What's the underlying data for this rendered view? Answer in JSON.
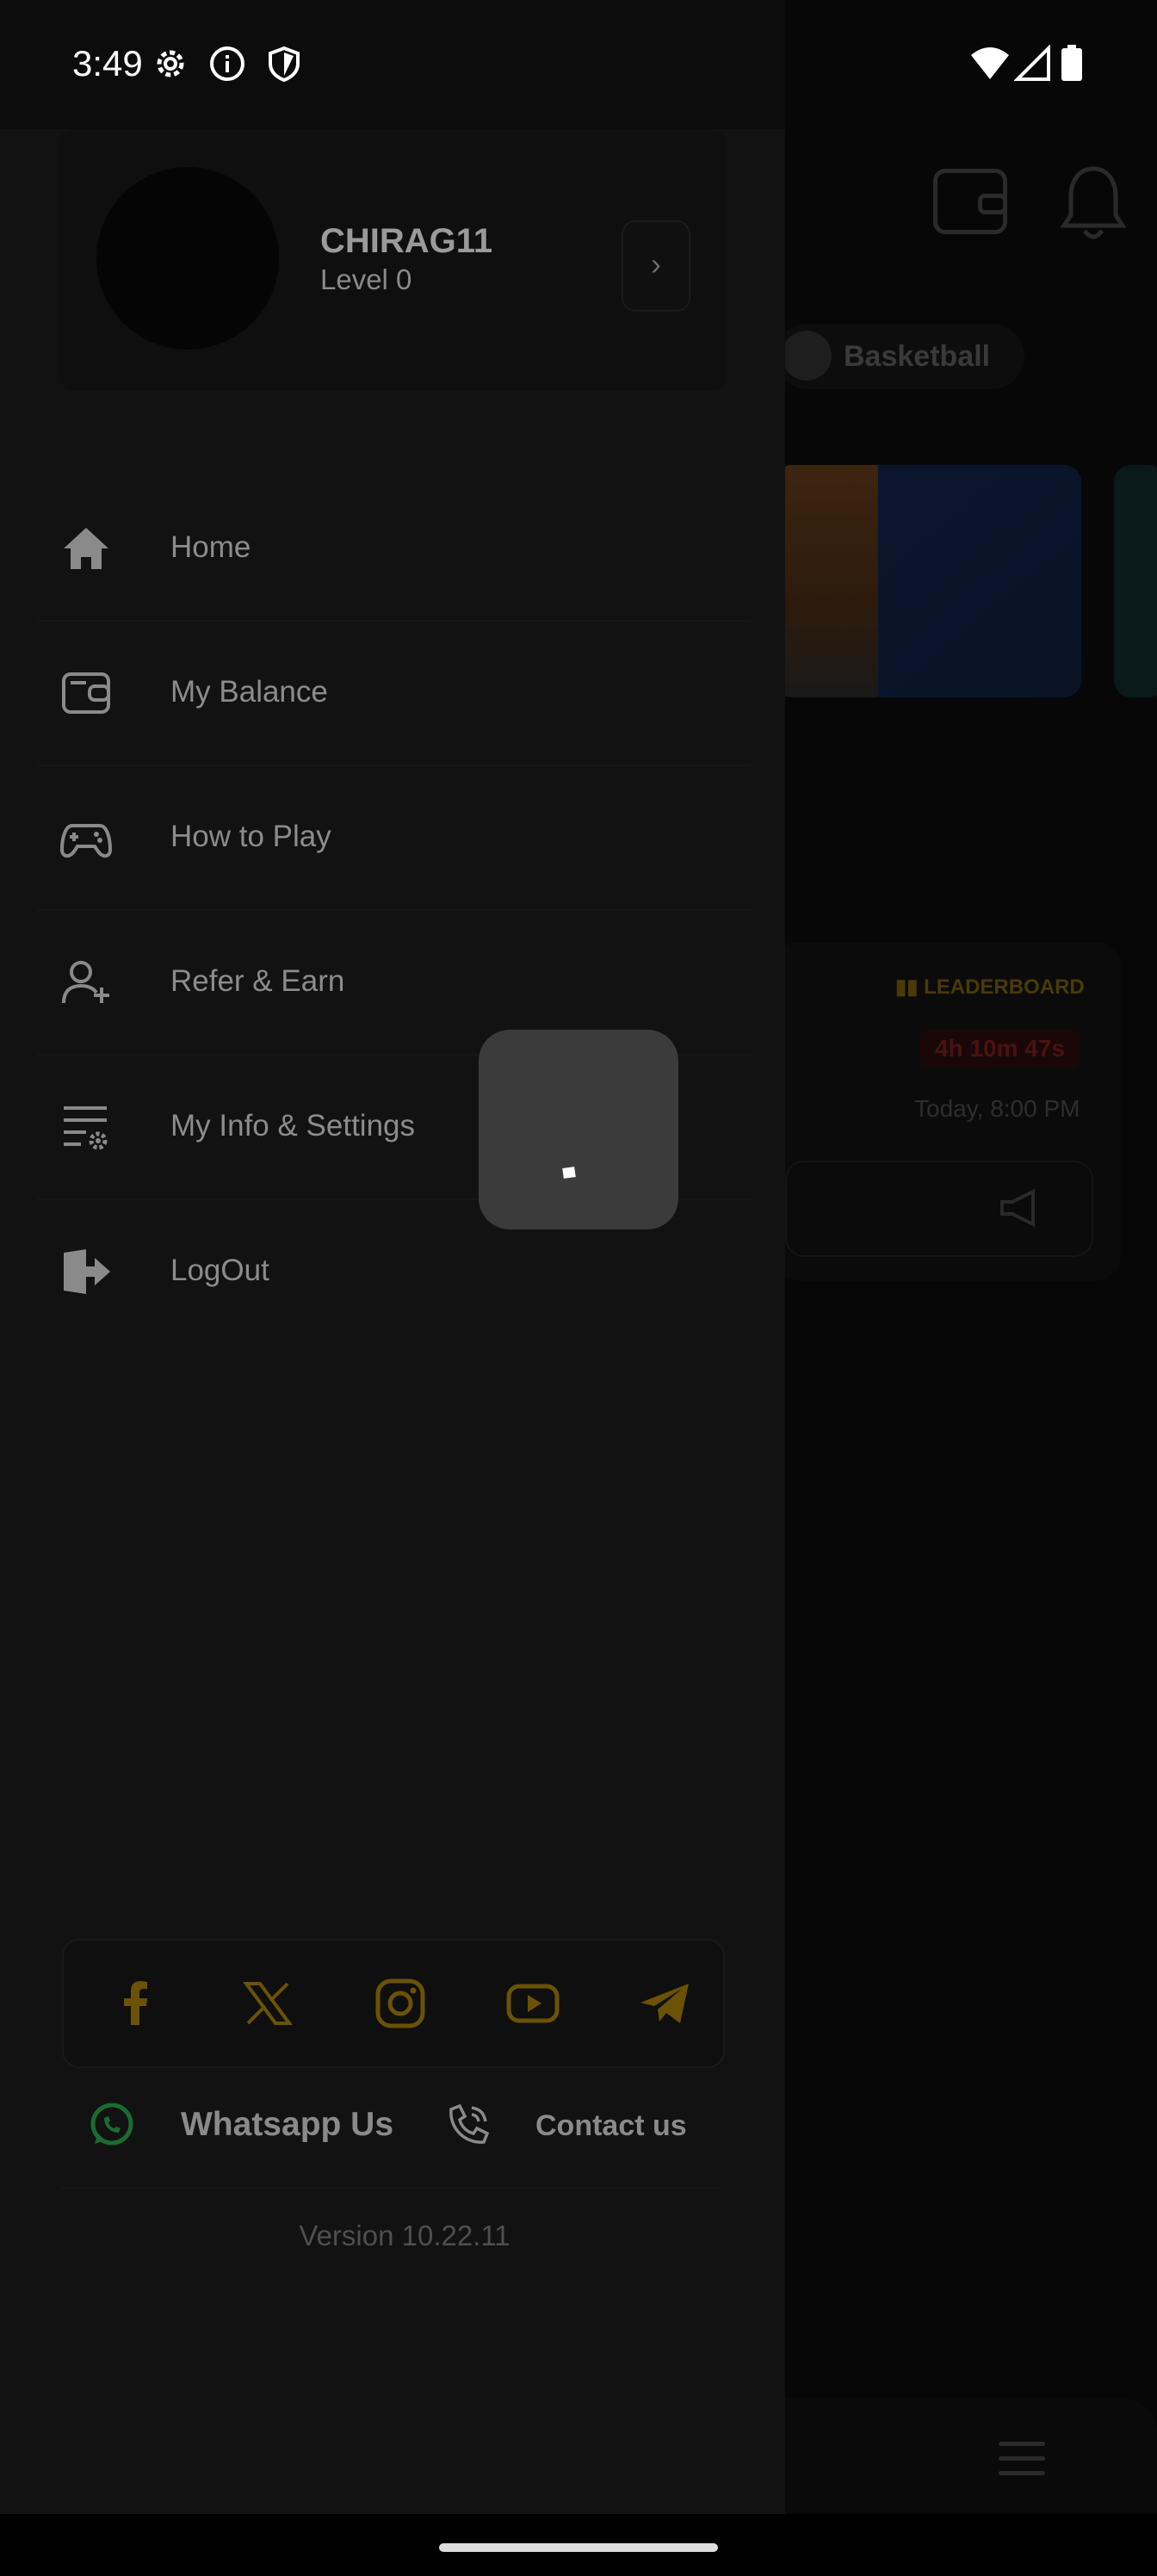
{
  "status_bar": {
    "time": "3:49",
    "icons_left": [
      "gear-icon",
      "info-icon",
      "shield-icon"
    ],
    "icons_right": [
      "wifi-icon",
      "signal-icon",
      "battery-icon"
    ]
  },
  "background": {
    "sport_chip": "Basketball",
    "leaderboard_label": "LEADERBOARD",
    "countdown": "4h 10m 47s",
    "match_time": "Today, 8:00 PM"
  },
  "drawer": {
    "profile": {
      "username": "CHIRAG11",
      "level": "Level 0"
    },
    "menu": [
      {
        "label": "Home",
        "icon": "home-icon"
      },
      {
        "label": "My Balance",
        "icon": "wallet-icon"
      },
      {
        "label": "How to Play",
        "icon": "gamepad-icon"
      },
      {
        "label": "Refer & Earn",
        "icon": "add-user-icon"
      },
      {
        "label": "My Info & Settings",
        "icon": "settings-list-icon"
      },
      {
        "label": "LogOut",
        "icon": "logout-icon"
      }
    ],
    "social": [
      "facebook-icon",
      "x-icon",
      "instagram-icon",
      "youtube-icon",
      "telegram-icon"
    ],
    "whatsapp_label": "Whatsapp Us",
    "contact_label": "Contact us",
    "version": "Version 10.22.11"
  },
  "colors": {
    "accent": "#6b5205",
    "whatsapp": "#1a6b32",
    "drawer_bg": "#121212"
  }
}
